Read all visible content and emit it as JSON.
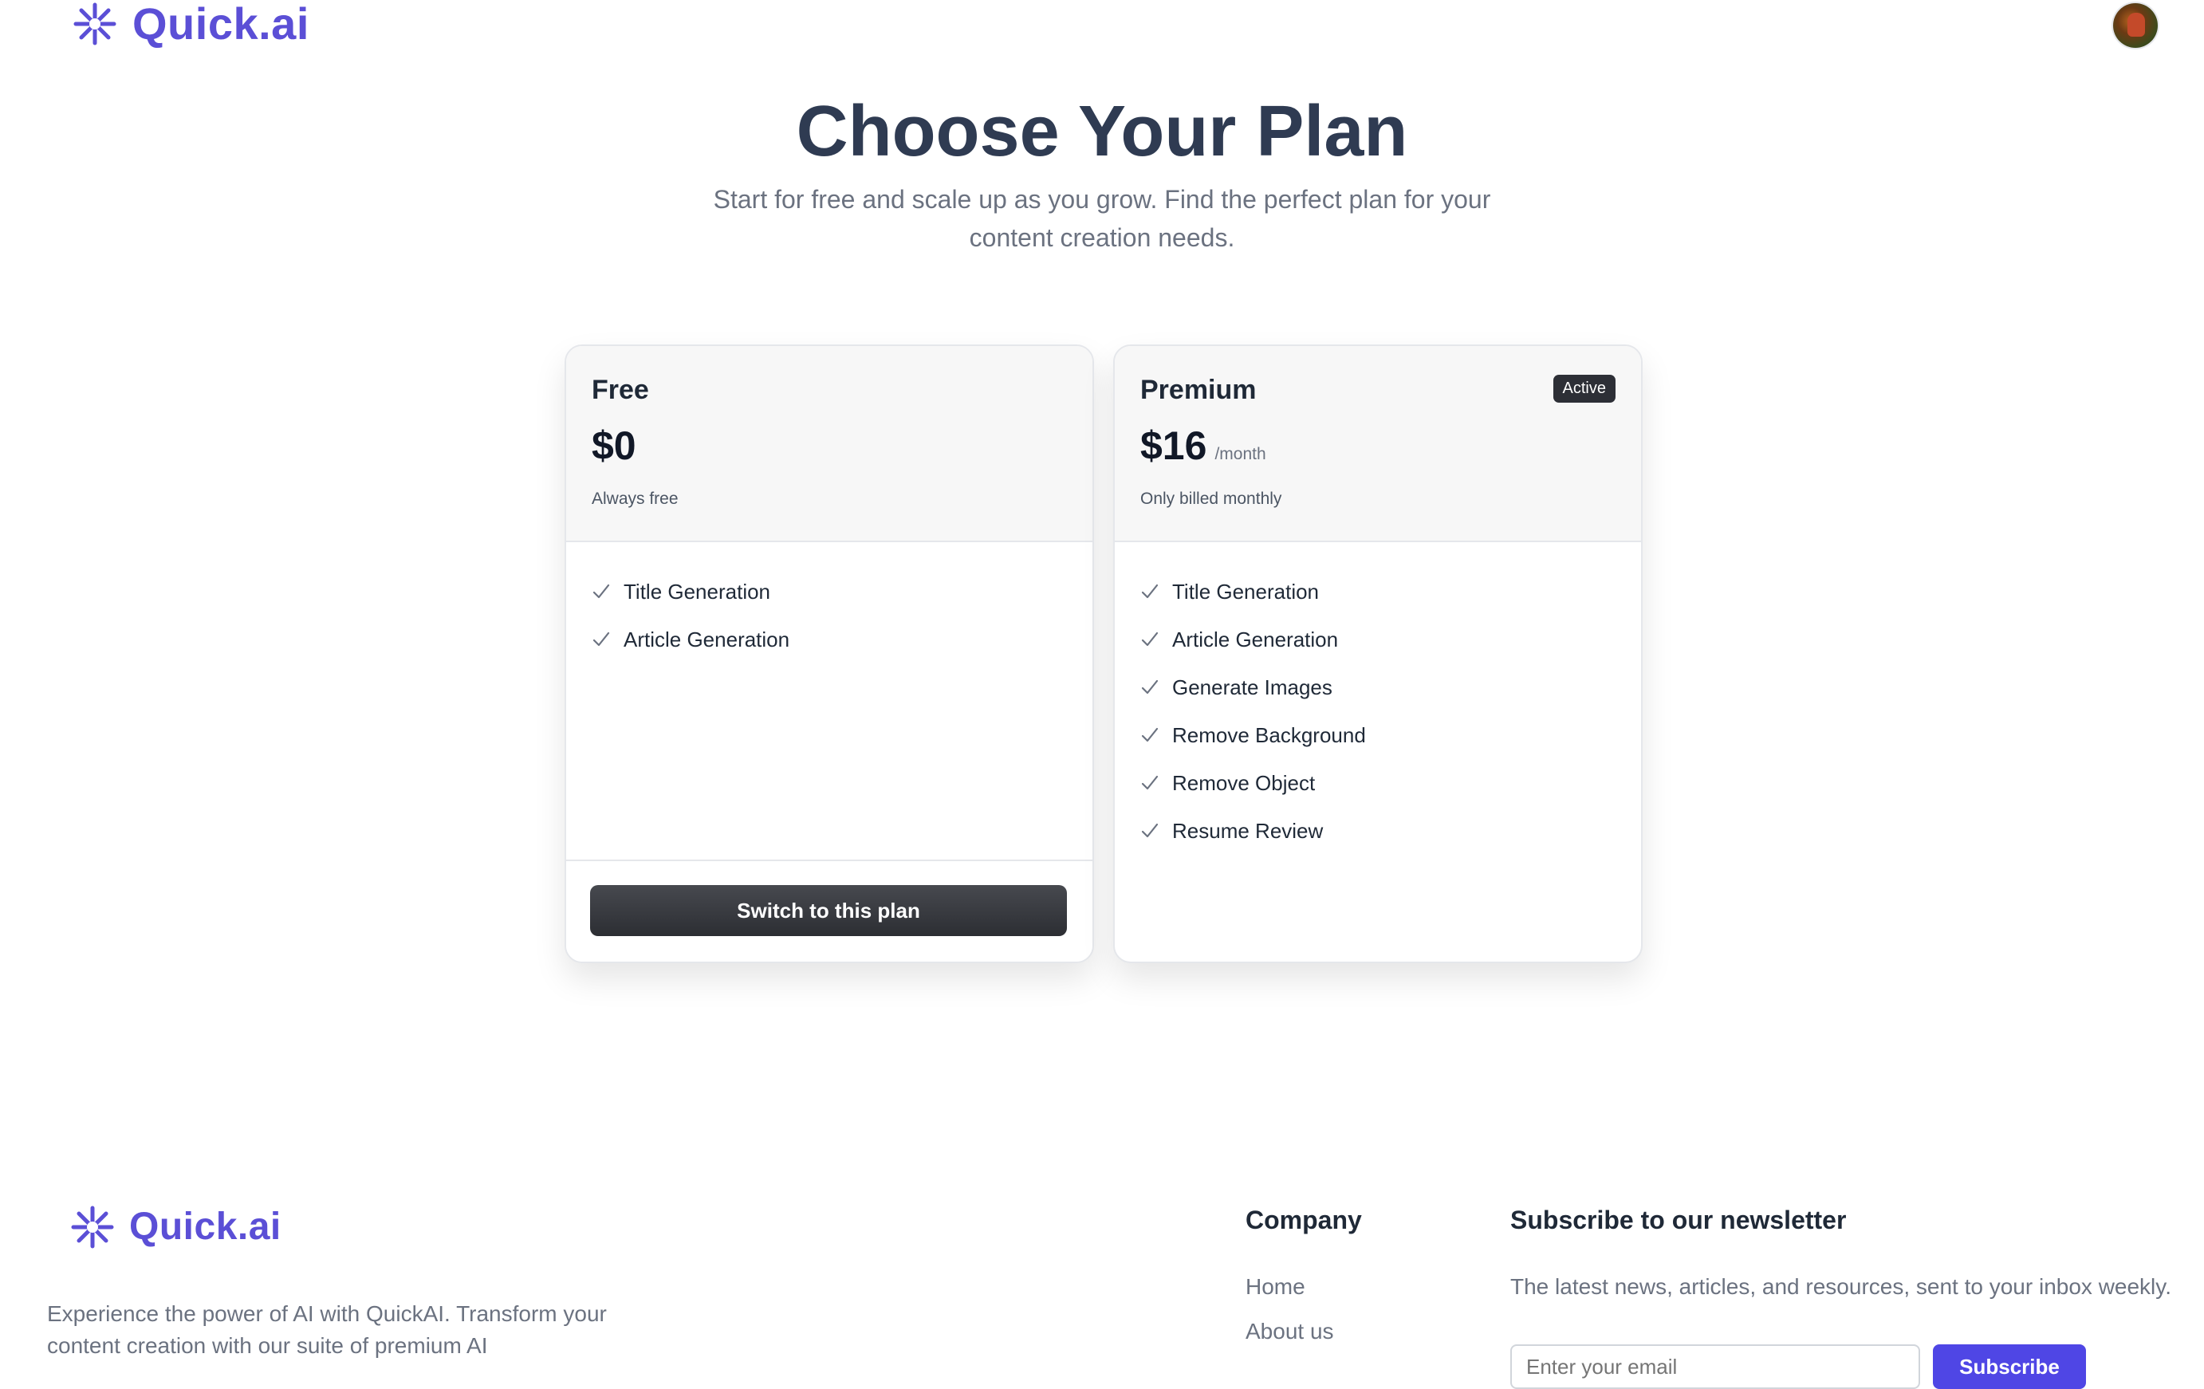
{
  "header": {
    "brand": "Quick.ai",
    "logo_icon": "asterisk-star-icon",
    "avatar_icon": "user-avatar"
  },
  "hero": {
    "title": "Choose Your Plan",
    "subtitle": "Start for free and scale up as you grow. Find the perfect plan for your content creation needs."
  },
  "plans": [
    {
      "name": "Free",
      "price": "$0",
      "period": "",
      "note": "Always free",
      "badge": "",
      "features": [
        "Title Generation",
        "Article Generation"
      ],
      "button_label": "Switch to this plan"
    },
    {
      "name": "Premium",
      "price": "$16",
      "period": "/month",
      "note": "Only billed monthly",
      "badge": "Active",
      "features": [
        "Title Generation",
        "Article Generation",
        "Generate Images",
        "Remove Background",
        "Remove Object",
        "Resume Review"
      ],
      "button_label": ""
    }
  ],
  "footer": {
    "brand": "Quick.ai",
    "description": "Experience the power of AI with QuickAI. Transform your content creation with our suite of premium AI",
    "company": {
      "title": "Company",
      "links": [
        "Home",
        "About us"
      ]
    },
    "newsletter": {
      "title": "Subscribe to our newsletter",
      "description": "The latest news, articles, and resources, sent to your inbox weekly.",
      "placeholder": "Enter your email",
      "button_label": "Subscribe"
    }
  },
  "colors": {
    "brand": "#5b4fd6",
    "title": "#2f3b52",
    "button_dark": "#2c2e33",
    "subscribe": "#4f46e5"
  }
}
